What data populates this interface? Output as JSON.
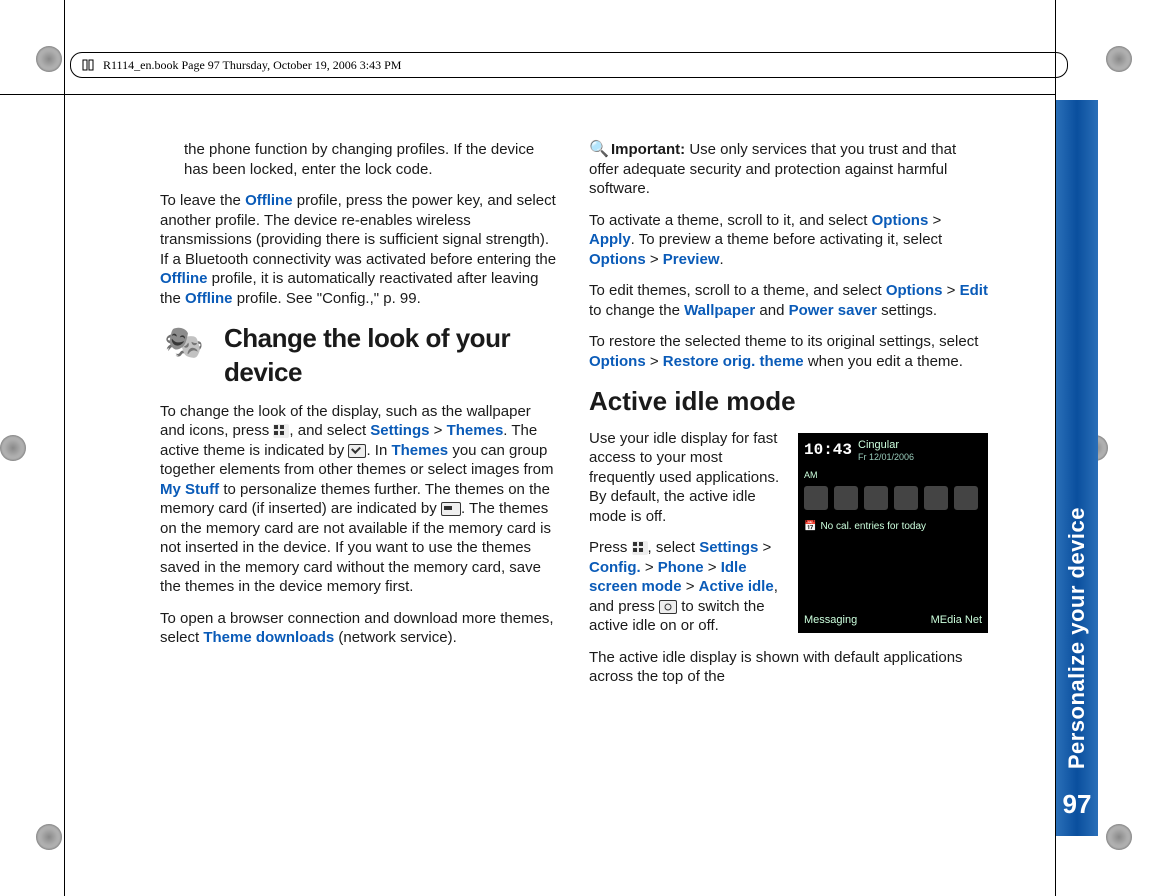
{
  "header": "R1114_en.book  Page 97  Thursday, October 19, 2006  3:43 PM",
  "sideTab": {
    "title": "Personalize your device",
    "pageNumber": "97"
  },
  "col1": {
    "p1": "the phone function by changing profiles. If the device has been locked, enter the lock code.",
    "p2a": "To leave the ",
    "p2b": "Offline",
    "p2c": " profile, press the power key, and select another profile. The device re-enables wireless transmissions (providing there is sufficient signal strength). If a Bluetooth connectivity was activated before entering the ",
    "p2d": "Offline",
    "p2e": " profile, it is automatically reactivated after leaving the ",
    "p2f": "Offline",
    "p2g": " profile. See \"Config.,\" p. 99.",
    "h1": "Change the look of your device",
    "p3a": "To change the look of the display, such as the wallpaper and icons, press ",
    "p3b": ", and select ",
    "p3c": "Settings",
    "p3d": " > ",
    "p3e": "Themes",
    "p3f": ". The active theme is indicated by ",
    "p3g": ". In ",
    "p3h": "Themes",
    "p3i": " you can group together elements from other themes or select images from ",
    "p3j": "My Stuff",
    "p3k": " to personalize themes further. The themes on the memory card (if inserted) are indicated by ",
    "p3l": ". The themes on the memory card are not available if the memory card is not inserted in the device. If you want to use the themes saved in the memory card without the memory card, save the themes in the device memory first.",
    "p4a": "To open a browser connection and download more themes, select ",
    "p4b": "Theme downloads",
    "p4c": " (network service)."
  },
  "col2": {
    "imp_label": "Important:",
    "imp_text": " Use only services that you trust and that offer adequate security and protection against harmful software.",
    "p1a": "To activate a theme, scroll to it, and select ",
    "p1b": "Options",
    "p1c": " > ",
    "p1d": "Apply",
    "p1e": ". To preview a theme before activating it, select ",
    "p1f": "Options",
    "p1g": " > ",
    "p1h": "Preview",
    "p1i": ".",
    "p2a": "To edit themes, scroll to a theme, and select ",
    "p2b": "Options",
    "p2c": " > ",
    "p2d": "Edit",
    "p2e": " to change the ",
    "p2f": "Wallpaper",
    "p2g": " and ",
    "p2h": "Power saver",
    "p2i": " settings.",
    "p3a": "To restore the selected theme to its original settings, select ",
    "p3b": "Options",
    "p3c": " > ",
    "p3d": "Restore orig. theme",
    "p3e": " when you edit a theme.",
    "h2": "Active idle mode",
    "p4": "Use your idle display for fast access to your most frequently used applications. By default, the active idle mode is off.",
    "p5a": "Press ",
    "p5b": ", select ",
    "p5c": "Settings",
    "p5d": " > ",
    "p5e": "Config.",
    "p5f": " > ",
    "p5g": "Phone",
    "p5h": " > ",
    "p5i": "Idle screen mode",
    "p5j": " > ",
    "p5k": "Active idle",
    "p5l": ", and press ",
    "p5m": " to switch the active idle on or off.",
    "p6": "The active idle display is shown with default applications across the top of the"
  },
  "screenshot": {
    "clock": "10:43",
    "ampm": "AM",
    "operator": "Cingular",
    "date": "Fr 12/01/2006",
    "calmsg": "No cal. entries for today",
    "softkey_left": "Messaging",
    "softkey_right": "MEdia Net"
  }
}
